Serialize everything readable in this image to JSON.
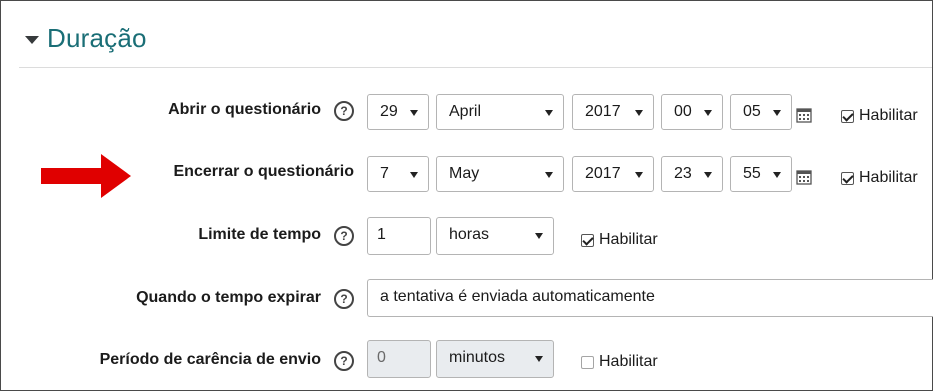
{
  "section": {
    "title": "Duração"
  },
  "rows": {
    "open": {
      "label": "Abrir o questionário",
      "day": "29",
      "month": "April",
      "year": "2017",
      "hour": "00",
      "minute": "05",
      "enable_label": "Habilitar"
    },
    "close": {
      "label": "Encerrar o questionário",
      "day": "7",
      "month": "May",
      "year": "2017",
      "hour": "23",
      "minute": "55",
      "enable_label": "Habilitar"
    },
    "timelimit": {
      "label": "Limite de tempo",
      "value": "1",
      "unit": "horas",
      "enable_label": "Habilitar"
    },
    "expire": {
      "label": "Quando o tempo expirar",
      "value": "a tentativa é enviada automaticamente"
    },
    "grace": {
      "label": "Período de carência de envio",
      "value": "0",
      "unit": "minutos",
      "enable_label": "Habilitar"
    }
  },
  "icons": {
    "help": "?"
  },
  "colors": {
    "title": "#1a6e76",
    "arrow": "#e00000"
  }
}
